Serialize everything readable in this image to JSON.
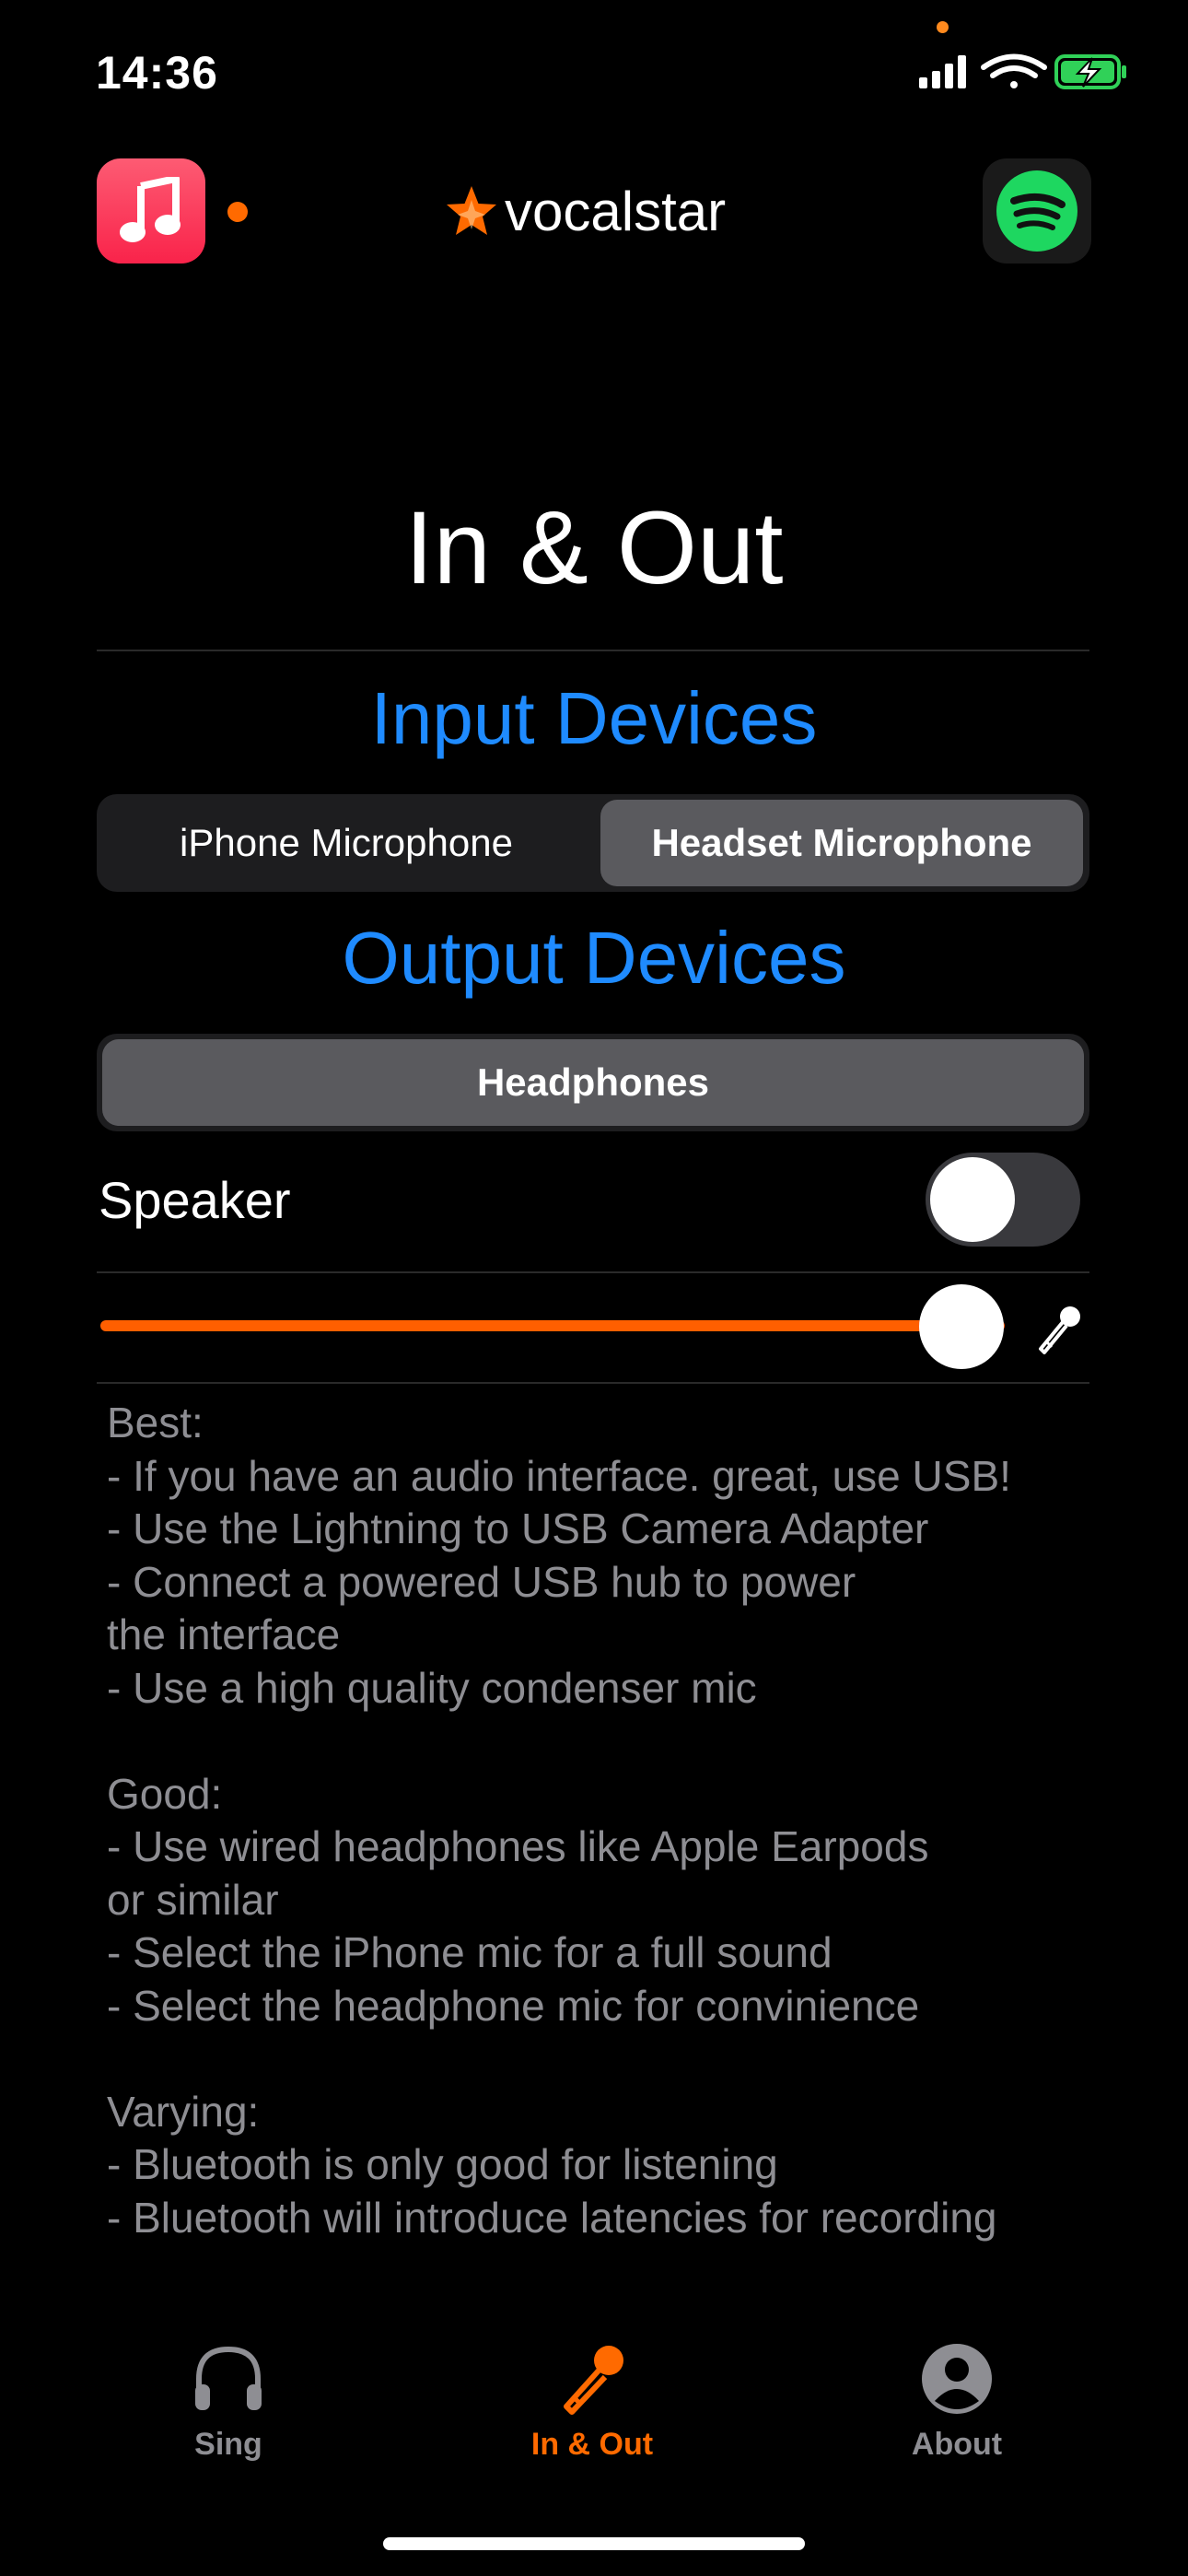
{
  "status_bar": {
    "time": "14:36",
    "icons": [
      "cellular-signal-icon",
      "wifi-icon",
      "battery-charging-icon"
    ],
    "battery_color": "#30d158"
  },
  "header": {
    "left_app_icon": "apple-music-icon",
    "right_app_icon": "spotify-icon",
    "brand": "vocalstar",
    "brand_accent": "#ff6a00"
  },
  "page": {
    "title": "In & Out"
  },
  "input": {
    "title": "Input Devices",
    "options": [
      "iPhone Microphone",
      "Headset Microphone"
    ],
    "selected": "Headset Microphone"
  },
  "output": {
    "title": "Output Devices",
    "options": [
      "Headphones"
    ],
    "selected": "Headphones"
  },
  "speaker": {
    "label": "Speaker",
    "enabled": false
  },
  "mic_level": {
    "value": 1.0,
    "icon": "microphone-icon",
    "track_color": "#ff5f00"
  },
  "tips": [
    "Best:",
    "- If you have an audio interface. great, use USB!",
    "- Use the Lightning to USB Camera Adapter",
    "- Connect a powered USB hub to power",
    "the interface",
    "- Use a high quality condenser mic",
    "",
    "Good:",
    "- Use wired headphones like Apple Earpods",
    "or similar",
    "- Select the iPhone mic for a full sound",
    "- Select the headphone mic for convinience",
    "",
    "Varying:",
    "- Bluetooth is only good for listening",
    "- Bluetooth will introduce latencies for recording"
  ],
  "tabs": [
    {
      "label": "Sing",
      "icon": "headphones-icon",
      "active": false
    },
    {
      "label": "In & Out",
      "icon": "microphone-icon",
      "active": true
    },
    {
      "label": "About",
      "icon": "person-circle-icon",
      "active": false
    }
  ],
  "colors": {
    "accent_blue": "#1f8bff",
    "accent_orange": "#ff6a00",
    "secondary_text": "#8e8e93"
  }
}
